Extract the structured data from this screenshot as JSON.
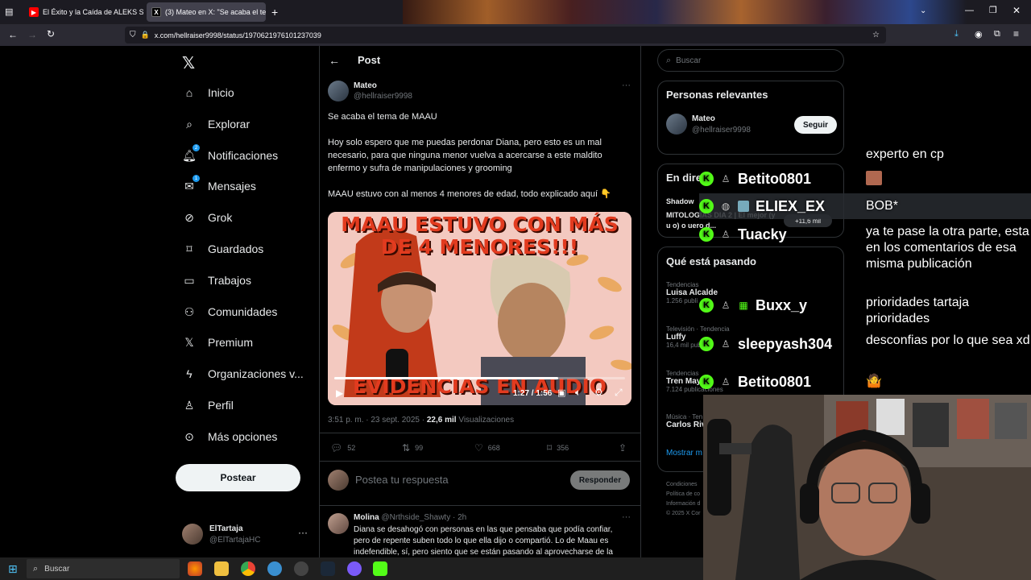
{
  "browser": {
    "tabs": [
      {
        "title": "El Éxito y la Caída de ALEKS SY..",
        "active": false
      },
      {
        "title": "(3) Mateo en X: \"Se acaba el te..",
        "active": true
      }
    ],
    "url": "x.com/hellraiser9998/status/1970621976101237039"
  },
  "nav": {
    "items": [
      {
        "label": "Inicio",
        "icon": "home-icon"
      },
      {
        "label": "Explorar",
        "icon": "search-icon"
      },
      {
        "label": "Notificaciones",
        "icon": "bell-icon",
        "badge": "2"
      },
      {
        "label": "Mensajes",
        "icon": "mail-icon",
        "badge": "1"
      },
      {
        "label": "Grok",
        "icon": "grok-icon"
      },
      {
        "label": "Guardados",
        "icon": "bookmark-icon"
      },
      {
        "label": "Trabajos",
        "icon": "briefcase-icon"
      },
      {
        "label": "Comunidades",
        "icon": "people-icon"
      },
      {
        "label": "Premium",
        "icon": "x-logo-icon"
      },
      {
        "label": "Organizaciones v...",
        "icon": "lightning-icon"
      },
      {
        "label": "Perfil",
        "icon": "person-icon"
      },
      {
        "label": "Más opciones",
        "icon": "more-circle-icon"
      }
    ],
    "post_button": "Postear",
    "account": {
      "name": "ElTartaja",
      "handle": "@ElTartajaHC"
    }
  },
  "post": {
    "header": "Post",
    "author": "Mateo",
    "handle": "@hellraiser9998",
    "text1": "Se acaba el tema de MAAU",
    "text2": "Hoy solo espero que me puedas perdonar Diana, pero esto es un mal necesario, para que ninguna menor vuelva a acercarse a este maldito enfermo y sufra de manipulaciones y grooming",
    "text3": "MAAU estuvo con al menos 4 menores de edad, todo explicado aquí 👇",
    "video": {
      "caption_top": "MAAU ESTUVO CON MÁS DE 4 MENORES!!!",
      "caption_bottom": "EVIDENCIAS EN AUDIO",
      "time": "1:27 / 1:56",
      "progress": 0.77
    },
    "time": "3:51 p. m. · 23 sept. 2025 ·",
    "views_count": "22,6 mil",
    "views_label": "Visualizaciones",
    "stats": {
      "replies": "52",
      "reposts": "99",
      "likes": "668",
      "bookmarks": "356"
    },
    "reply_placeholder": "Postea tu respuesta",
    "reply_button": "Responder"
  },
  "reply": {
    "author": "Molina",
    "handle": "@Nrthside_Shawty · 2h",
    "text": "Diana se desahogó con personas en las que pensaba que podía confiar, pero de repente suben todo lo que ella dijo o compartió. Lo de Maau es indefendible, sí, pero siento que se están pasando al aprovecharse de la"
  },
  "sidebar": {
    "search_placeholder": "Buscar",
    "relevant_title": "Personas relevantes",
    "relevant_name": "Mateo",
    "relevant_handle": "@hellraiser9998",
    "follow_button": "Seguir",
    "live_title": "En dire",
    "live_channel": "Shadow",
    "live_text": "MITOLOGIAS DIA 2 | El mejor (y u o) o uero d...",
    "live_viewers": "+11,6 mil",
    "trends_title": "Qué está pasando",
    "trends": [
      {
        "category": "Tendencias",
        "name": "Luisa Alcalde",
        "count": "1.256 publi"
      },
      {
        "category": "Televisión · Tendencia",
        "name": "Luffy",
        "count": "16,4 mil publ"
      },
      {
        "category": "Tendencias",
        "name": "Tren May",
        "count": "7.124 publicaciones"
      },
      {
        "category": "Música · Ten",
        "name": "Carlos Riv",
        "count": ""
      }
    ],
    "show_more": "Mostrar m",
    "footer": [
      "Condiciones",
      "Política de co",
      "Información d",
      "© 2025 X Cor"
    ]
  },
  "chat": {
    "rows": [
      {
        "user": "Betito0801",
        "msg": "experto en cp"
      },
      {
        "user": "ELIEX_EX",
        "msg": "BOB*"
      },
      {
        "user": "Tuacky",
        "msg": "ya te pase la otra parte, esta en los comentarios de esa misma publicación"
      },
      {
        "user": "Buxx_y",
        "msg": "prioridades tartaja prioridades"
      },
      {
        "user": "sleepyash304",
        "msg": "desconfias por lo que sea xd"
      },
      {
        "user": "Betito0801",
        "msg": "🤷"
      }
    ]
  },
  "taskbar": {
    "search_placeholder": "Buscar"
  },
  "colors": {
    "accent": "#1d9bf0",
    "kick_green": "#53fc18",
    "bg": "#000000",
    "border": "#2f3336"
  }
}
